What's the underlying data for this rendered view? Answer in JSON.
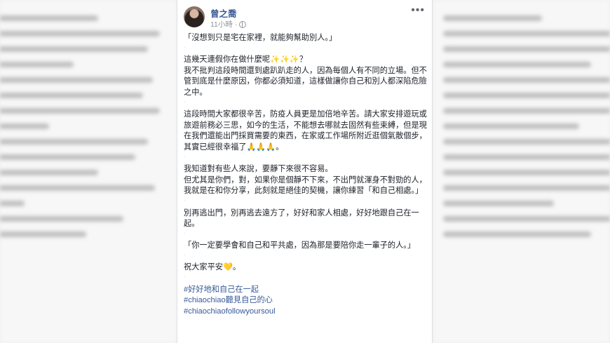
{
  "post": {
    "author": "曾之喬",
    "time": "11小時",
    "separator": "·",
    "more_label": "•••",
    "paragraphs": [
      "「沒想到只是宅在家裡，就能夠幫助別人。」",
      "這幾天連假你在做什麼呢✨✨✨？\n我不批判這段時間還到處趴趴走的人，因為每個人有不同的立場。但不管到底是什麼原因，你都必須知道，這樣做讓你自己和別人都深陷危險之中。",
      "這段時間大家都很辛苦，防疫人員更是加倍地辛苦。請大家安排遊玩或旅遊前務必三思，如今的生活，不能想去哪就去固然有些束縛，但是現在我們還能出門採買需要的東西，在家或工作場所附近逛個氣散個步，其實已經很幸福了🙏🙏🙏。",
      "我知道對有些人來說，要靜下來很不容易。\n但尤其是你們，對，如果你是個靜不下來，不出門就渾身不對勁的人，我就是在和你分享，此刻就是絕佳的契機，讓你練習「和自己相處。」",
      "別再逃出門，別再逃去遠方了，好好和家人相處，好好地跟自己在一起。",
      "「你一定要學會和自己和平共處，因為那是要陪你走一輩子的人。」",
      "祝大家平安💛。"
    ],
    "hashtags": [
      "#好好地和自己在一起",
      "#chiaochiao聽見自己的心",
      "#chiaochiaofollowyoursoul"
    ]
  }
}
